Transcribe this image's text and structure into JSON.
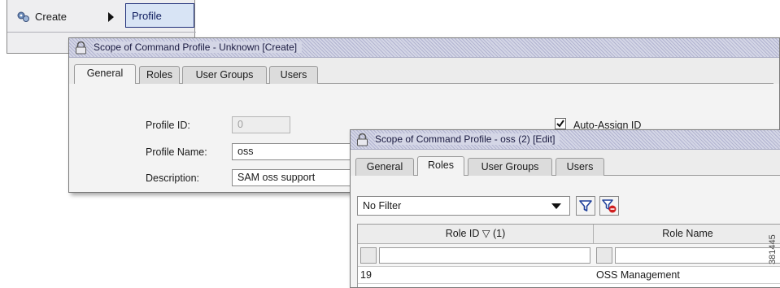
{
  "context_menu": {
    "create_label": "Create",
    "submenu_item": "Profile"
  },
  "window_create": {
    "title": "Scope of Command Profile - Unknown [Create]",
    "tabs": [
      "General",
      "Roles",
      "User Groups",
      "Users"
    ],
    "active_tab": "General",
    "fields": {
      "profile_id_label": "Profile ID:",
      "profile_id_value": "0",
      "profile_name_label": "Profile Name:",
      "profile_name_value": "oss",
      "description_label": "Description:",
      "description_value": "SAM oss support"
    },
    "auto_assign": {
      "label": "Auto-Assign ID",
      "checked": true
    }
  },
  "window_edit": {
    "title": "Scope of Command Profile - oss (2) [Edit]",
    "tabs": [
      "General",
      "Roles",
      "User Groups",
      "Users"
    ],
    "active_tab": "Roles",
    "filter_select": "No Filter",
    "table": {
      "columns": [
        "Role ID ▽ (1)",
        "Role Name"
      ],
      "rows": [
        {
          "role_id": "19",
          "role_name": "OSS Management"
        }
      ]
    }
  },
  "figure_id": "381445",
  "colors": {
    "title_bar": "#d4d6e6",
    "selected_menu": "#d8e4f5",
    "filter_icon": "#1e3f9a",
    "clear_filter_icon": "#d02020"
  }
}
